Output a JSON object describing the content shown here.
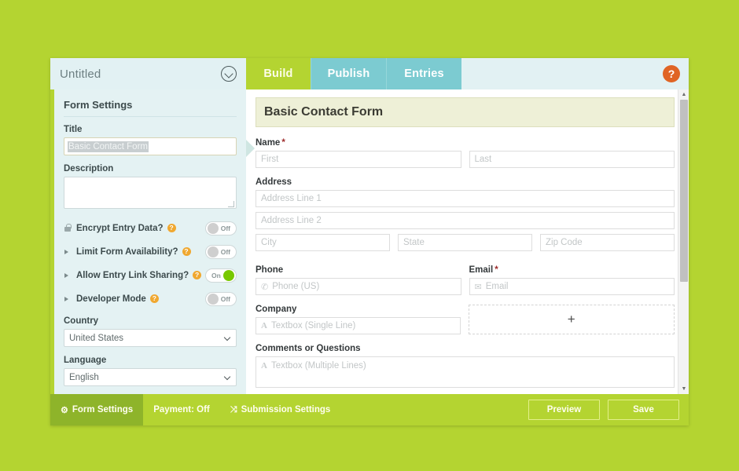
{
  "theme": {
    "page_bg": "#b4d431",
    "accent_green": "#b4d431",
    "tab_teal": "#7ccbd1",
    "sidebar_bg": "#e4f2f3",
    "help_orange": "#e06424",
    "toggle_on": "#78c800"
  },
  "header": {
    "form_name": "Untitled",
    "dropdown_icon": "chevron-down-circle-icon",
    "help_icon": "help-icon",
    "help_label": "?",
    "tabs": [
      {
        "label": "Build",
        "active": true
      },
      {
        "label": "Publish",
        "active": false
      },
      {
        "label": "Entries",
        "active": false
      }
    ]
  },
  "sidebar": {
    "heading": "Form Settings",
    "title": {
      "label": "Title",
      "value": "Basic Contact Form",
      "selected": true
    },
    "description": {
      "label": "Description",
      "value": ""
    },
    "toggles": [
      {
        "label": "Encrypt Entry Data?",
        "lead_icon": "lock-icon",
        "help_icon": "help-icon",
        "help_label": "?",
        "state": "Off",
        "on": false
      },
      {
        "label": "Limit Form Availability?",
        "lead_icon": "triangle-right-icon",
        "help_icon": "help-icon",
        "help_label": "?",
        "state": "Off",
        "on": false
      },
      {
        "label": "Allow Entry Link Sharing?",
        "lead_icon": "triangle-right-icon",
        "help_icon": "help-icon",
        "help_label": "?",
        "state": "On",
        "on": true
      },
      {
        "label": "Developer Mode",
        "lead_icon": "triangle-right-icon",
        "help_icon": "help-icon",
        "help_label": "?",
        "state": "Off",
        "on": false
      }
    ],
    "country": {
      "label": "Country",
      "value": "United States"
    },
    "language": {
      "label": "Language",
      "value": "English"
    }
  },
  "form": {
    "title": "Basic Contact Form",
    "fields": {
      "name": {
        "label": "Name",
        "required": true,
        "required_mark": "*",
        "first_placeholder": "First",
        "last_placeholder": "Last"
      },
      "address": {
        "label": "Address",
        "line1_placeholder": "Address Line 1",
        "line2_placeholder": "Address Line 2",
        "city_placeholder": "City",
        "state_placeholder": "State",
        "zip_placeholder": "Zip Code"
      },
      "phone": {
        "label": "Phone",
        "required": false,
        "icon": "phone-icon",
        "icon_glyph": "✆",
        "placeholder": "Phone (US)"
      },
      "email": {
        "label": "Email",
        "required": true,
        "required_mark": "*",
        "icon": "envelope-icon",
        "icon_glyph": "✉",
        "placeholder": "Email"
      },
      "company": {
        "label": "Company",
        "icon": "text-a-icon",
        "icon_glyph": "A",
        "placeholder": "Textbox (Single Line)"
      },
      "add_field": {
        "icon": "plus-icon",
        "label": "+"
      },
      "comments": {
        "label": "Comments or Questions",
        "icon": "text-a-icon",
        "icon_glyph": "A",
        "placeholder": "Textbox (Multiple Lines)"
      }
    }
  },
  "scrollbar": {
    "up_arrow": "▲",
    "down_arrow": "▼"
  },
  "footer": {
    "items": [
      {
        "label": "Form Settings",
        "icon": "gear-icon",
        "icon_glyph": "⚙",
        "active": true
      },
      {
        "label": "Payment: Off",
        "icon": "",
        "icon_glyph": "",
        "active": false
      },
      {
        "label": "Submission Settings",
        "icon": "shuffle-icon",
        "icon_glyph": "⤨",
        "active": false
      }
    ],
    "preview_label": "Preview",
    "save_label": "Save"
  }
}
